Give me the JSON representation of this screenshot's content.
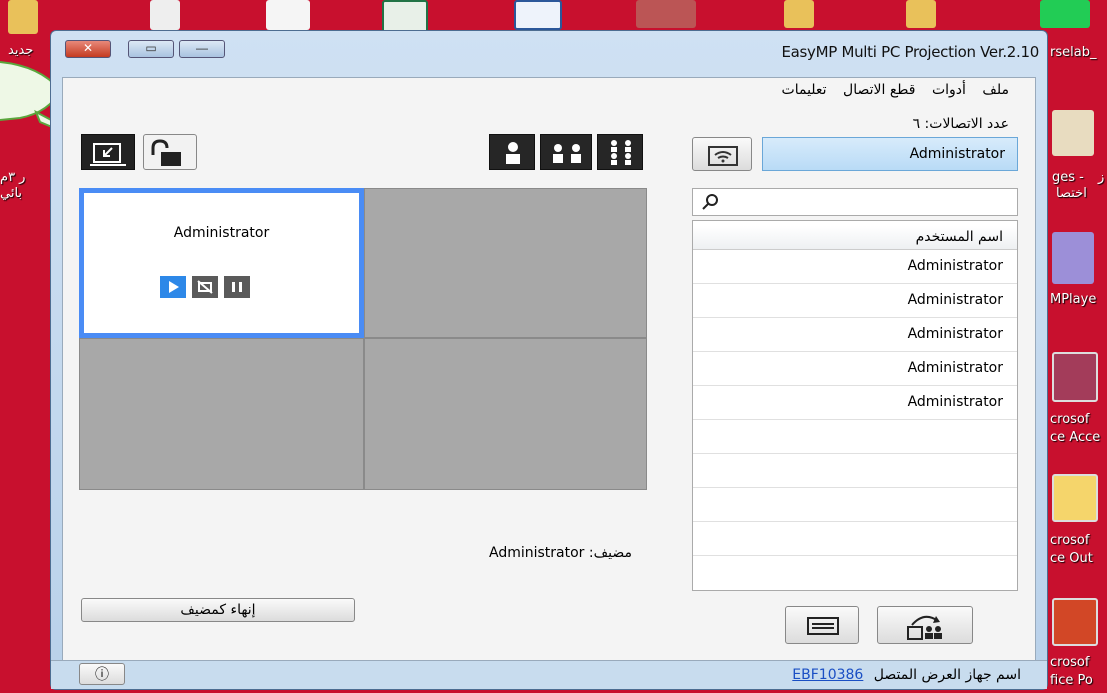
{
  "desktop": {
    "left_labels": [
      "جديد",
      "ر ۳م",
      "بائي"
    ],
    "right_labels": [
      "rselab_",
      "ges -",
      "ز",
      "اختصا",
      "MPlaye",
      "crosof",
      "ce Acce",
      "crosof",
      "ce Out",
      "crosof",
      "fice Po"
    ]
  },
  "window": {
    "title": "EasyMP Multi PC Projection Ver.2.10",
    "caption_buttons": {
      "close": "✕",
      "maximize": "▭",
      "minimize": "—"
    }
  },
  "menu": {
    "items": [
      "ملف",
      "أدوات",
      "قطع الاتصال",
      "تعليمات"
    ]
  },
  "connections": {
    "label": "عدد الاتصالات: ٦"
  },
  "left": {
    "cell_user": "Administrator",
    "host_label": "مضيف: Administrator",
    "end_host_button": "إنهاء كمضيف"
  },
  "right": {
    "selected_user": "Administrator",
    "search_placeholder": "",
    "list_header": "اسم المستخدم",
    "users": [
      "Administrator",
      "Administrator",
      "Administrator",
      "Administrator",
      "Administrator"
    ]
  },
  "status": {
    "info_icon": "ⓘ",
    "device_label": "اسم جهاز العرض المتصل",
    "device_name": "EBF10386"
  }
}
